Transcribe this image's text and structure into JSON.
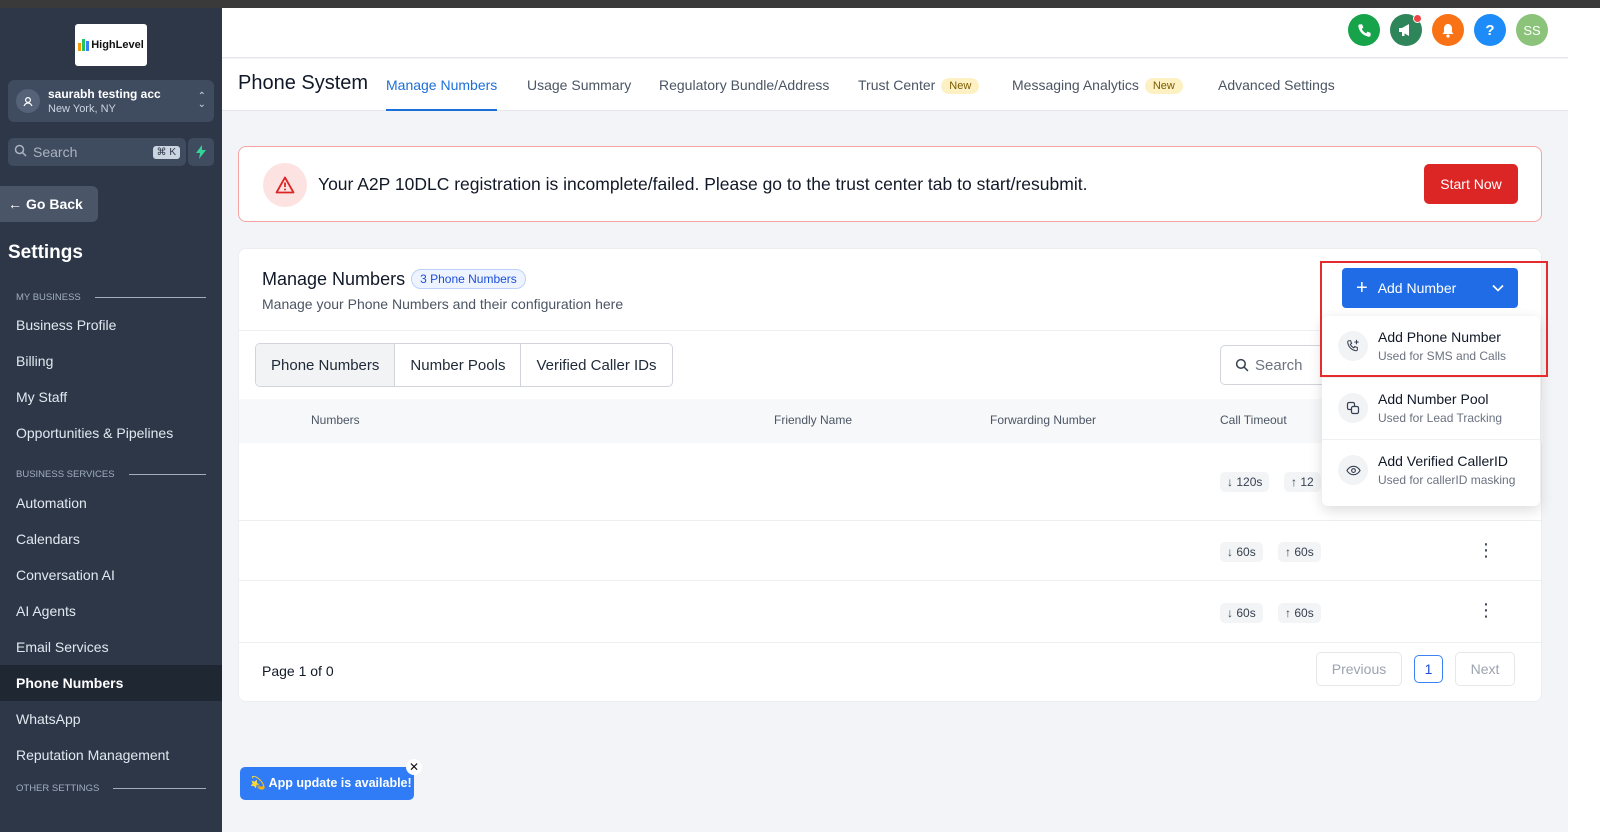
{
  "sidebar": {
    "logo_text": "HighLevel",
    "account": {
      "name": "saurabh testing acc",
      "location": "New York, NY"
    },
    "search": {
      "placeholder": "Search",
      "shortcut": "⌘ K"
    },
    "go_back": "Go Back",
    "title": "Settings",
    "sections": {
      "my_business": "MY BUSINESS",
      "business_services": "BUSINESS SERVICES",
      "other_settings": "OTHER SETTINGS"
    },
    "items": [
      {
        "label": "Business Profile"
      },
      {
        "label": "Billing"
      },
      {
        "label": "My Staff"
      },
      {
        "label": "Opportunities & Pipelines"
      },
      {
        "label": "Automation"
      },
      {
        "label": "Calendars"
      },
      {
        "label": "Conversation AI"
      },
      {
        "label": "AI Agents"
      },
      {
        "label": "Email Services"
      },
      {
        "label": "Phone Numbers",
        "active": true
      },
      {
        "label": "WhatsApp"
      },
      {
        "label": "Reputation Management"
      }
    ]
  },
  "topbar": {
    "icons": [
      {
        "name": "phone-icon",
        "color": "#16a34a"
      },
      {
        "name": "megaphone-icon",
        "color": "#2f855a"
      },
      {
        "name": "bell-icon",
        "color": "#f97316"
      },
      {
        "name": "help-icon",
        "color": "#1d8cf8"
      }
    ],
    "avatar_initials": "SS",
    "avatar_color": "#8bc37a"
  },
  "subnav": {
    "title": "Phone System",
    "tabs": [
      {
        "label": "Manage Numbers",
        "active": true
      },
      {
        "label": "Usage Summary"
      },
      {
        "label": "Regulatory Bundle/Address"
      },
      {
        "label": "Trust Center",
        "badge": "New"
      },
      {
        "label": "Messaging Analytics",
        "badge": "New"
      },
      {
        "label": "Advanced Settings"
      }
    ]
  },
  "alert": {
    "message": "Your A2P 10DLC registration is incomplete/failed. Please go to the trust center tab to start/resubmit.",
    "button": "Start Now"
  },
  "card": {
    "title": "Manage Numbers",
    "count_badge": "3 Phone Numbers",
    "subtitle": "Manage your Phone Numbers and their configuration here",
    "segments": [
      "Phone Numbers",
      "Number Pools",
      "Verified Caller IDs"
    ],
    "search_placeholder": "Search",
    "columns": [
      "Numbers",
      "Friendly Name",
      "Forwarding Number",
      "Call Timeout"
    ],
    "rows": [
      {
        "in": "120s",
        "out": "12"
      },
      {
        "in": "60s",
        "out": "60s"
      },
      {
        "in": "60s",
        "out": "60s"
      }
    ],
    "pagination": {
      "label": "Page 1 of 0",
      "previous": "Previous",
      "page": "1",
      "next": "Next"
    }
  },
  "add_number": {
    "button": "Add Number",
    "menu": [
      {
        "title": "Add Phone Number",
        "subtitle": "Used for SMS and Calls",
        "icon": "phone-plus-icon"
      },
      {
        "title": "Add Number Pool",
        "subtitle": "Used for Lead Tracking",
        "icon": "number-pool-icon"
      },
      {
        "title": "Add Verified CallerID",
        "subtitle": "Used for callerID masking",
        "icon": "eye-icon"
      }
    ]
  },
  "toast": {
    "message": "💫 App update is available!",
    "close": "✕"
  }
}
